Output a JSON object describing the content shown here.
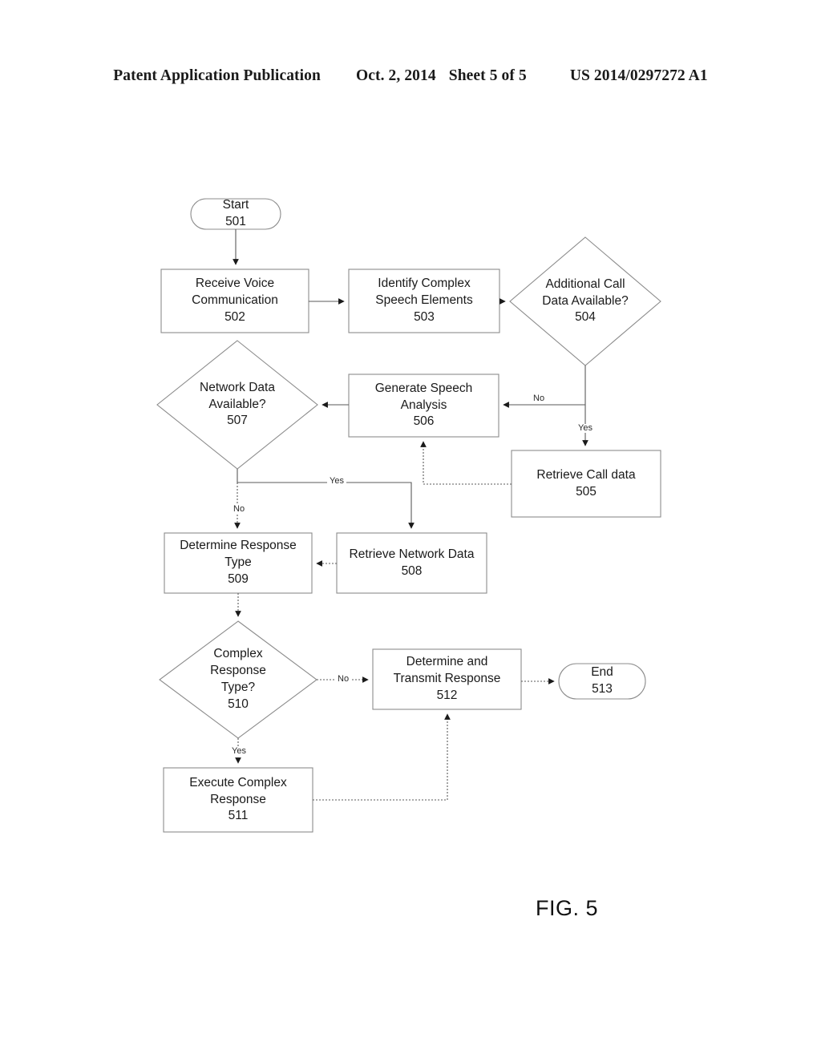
{
  "header": {
    "publication": "Patent Application Publication",
    "date": "Oct. 2, 2014",
    "sheet": "Sheet 5 of 5",
    "patent_number": "US 2014/0297272 A1"
  },
  "figure": {
    "caption": "FIG. 5"
  },
  "chart_data": {
    "type": "diagram",
    "title": "FIG. 5",
    "nodes": [
      {
        "id": "501",
        "shape": "terminator",
        "lines": [
          "Start",
          "501"
        ]
      },
      {
        "id": "502",
        "shape": "process",
        "lines": [
          "Receive Voice",
          "Communication",
          "502"
        ]
      },
      {
        "id": "503",
        "shape": "process",
        "lines": [
          "Identify Complex",
          "Speech Elements",
          "503"
        ]
      },
      {
        "id": "504",
        "shape": "decision",
        "lines": [
          "Additional Call",
          "Data Available?",
          "504"
        ]
      },
      {
        "id": "505",
        "shape": "process",
        "lines": [
          "Retrieve Call data",
          "505"
        ]
      },
      {
        "id": "506",
        "shape": "process",
        "lines": [
          "Generate Speech",
          "Analysis",
          "506"
        ]
      },
      {
        "id": "507",
        "shape": "decision",
        "lines": [
          "Network Data",
          "Available?",
          "507"
        ]
      },
      {
        "id": "508",
        "shape": "process",
        "lines": [
          "Retrieve Network Data",
          "508"
        ]
      },
      {
        "id": "509",
        "shape": "process",
        "lines": [
          "Determine Response",
          "Type",
          "509"
        ]
      },
      {
        "id": "510",
        "shape": "decision",
        "lines": [
          "Complex",
          "Response",
          "Type?",
          "510"
        ]
      },
      {
        "id": "511",
        "shape": "process",
        "lines": [
          "Execute Complex",
          "Response",
          "511"
        ]
      },
      {
        "id": "512",
        "shape": "process",
        "lines": [
          "Determine and",
          "Transmit Response",
          "512"
        ]
      },
      {
        "id": "513",
        "shape": "terminator",
        "lines": [
          "End",
          "513"
        ]
      }
    ],
    "edges": [
      {
        "from": "501",
        "to": "502",
        "label": ""
      },
      {
        "from": "502",
        "to": "503",
        "label": ""
      },
      {
        "from": "503",
        "to": "504",
        "label": ""
      },
      {
        "from": "504",
        "to": "505",
        "label": "Yes"
      },
      {
        "from": "504",
        "to": "506",
        "label": "No"
      },
      {
        "from": "505",
        "to": "506",
        "label": ""
      },
      {
        "from": "506",
        "to": "507",
        "label": ""
      },
      {
        "from": "507",
        "to": "508",
        "label": "Yes"
      },
      {
        "from": "507",
        "to": "509",
        "label": "No"
      },
      {
        "from": "508",
        "to": "509",
        "label": ""
      },
      {
        "from": "509",
        "to": "510",
        "label": ""
      },
      {
        "from": "510",
        "to": "511",
        "label": "Yes"
      },
      {
        "from": "510",
        "to": "512",
        "label": "No"
      },
      {
        "from": "511",
        "to": "512",
        "label": ""
      },
      {
        "from": "512",
        "to": "513",
        "label": ""
      }
    ],
    "edge_labels": [
      {
        "name": "edge-504-no",
        "text": "No"
      },
      {
        "name": "edge-504-yes",
        "text": "Yes"
      },
      {
        "name": "edge-507-yes",
        "text": "Yes"
      },
      {
        "name": "edge-507-no",
        "text": "No"
      },
      {
        "name": "edge-510-no",
        "text": "No"
      },
      {
        "name": "edge-510-yes",
        "text": "Yes"
      }
    ],
    "colors": {
      "stroke": "#8c8c8c",
      "text": "#1a1a1a",
      "background": "#ffffff"
    }
  }
}
